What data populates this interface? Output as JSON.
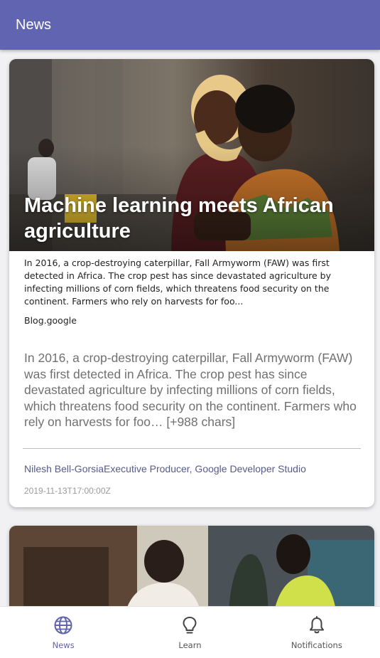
{
  "appbar": {
    "title": "News"
  },
  "articles": [
    {
      "image": "photo of a woman in a headscarf and a child looking at a phone",
      "title": "Machine learning meets African agriculture",
      "description": "In 2016, a crop-destroying caterpillar, Fall Armyworm (FAW) was first detected in Africa. The crop pest has since devastated agriculture by infecting millions of corn fields, which threatens food security on the continent. Farmers who rely on harvests for foo...",
      "source": "Blog.google",
      "content": "In 2016, a crop-destroying caterpillar, Fall Armyworm (FAW) was first detected in Africa. The crop pest has since devastated agriculture by infecting millions of corn fields, which threatens food security on the continent. Farmers who rely on harvests for foo… [+988 chars]",
      "author": "Nilesh Bell-GorsiaExecutive Producer, Google Developer Studio",
      "published_at": "2019-11-13T17:00:00Z"
    },
    {
      "image": "photo of workers in a kitchen and workshop"
    }
  ],
  "bottom_nav": {
    "items": [
      {
        "label": "News",
        "icon": "globe-icon",
        "active": true
      },
      {
        "label": "Learn",
        "icon": "lightbulb-icon",
        "active": false
      },
      {
        "label": "Notifications",
        "icon": "bell-icon",
        "active": false
      }
    ]
  },
  "colors": {
    "primary": "#6164b0",
    "author_text": "#575a8a"
  }
}
